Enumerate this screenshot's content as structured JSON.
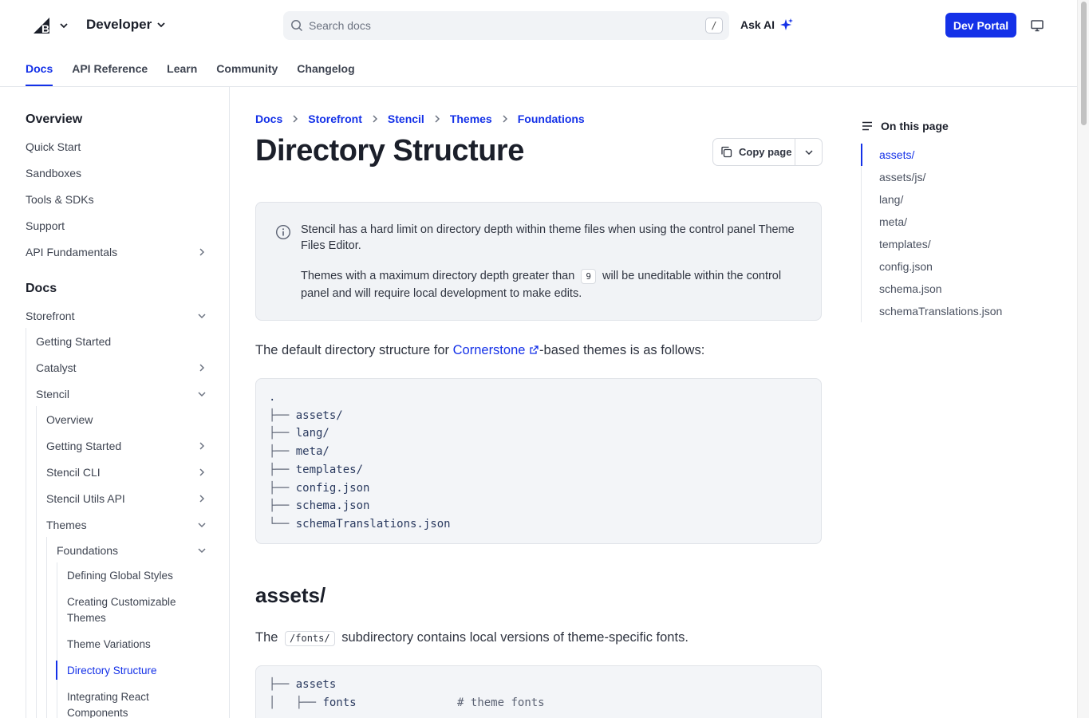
{
  "header": {
    "brand": "Developer",
    "search_placeholder": "Search docs",
    "search_shortcut": "/",
    "ask_ai": "Ask AI",
    "dev_portal": "Dev Portal"
  },
  "nav_tabs": [
    {
      "label": "Docs",
      "active": true
    },
    {
      "label": "API Reference"
    },
    {
      "label": "Learn"
    },
    {
      "label": "Community"
    },
    {
      "label": "Changelog"
    }
  ],
  "sidebar": {
    "section1_title": "Overview",
    "section1_items": [
      "Quick Start",
      "Sandboxes",
      "Tools & SDKs",
      "Support",
      "API Fundamentals"
    ],
    "section2_title": "Docs",
    "storefront": "Storefront",
    "getting_started": "Getting Started",
    "catalyst": "Catalyst",
    "stencil": "Stencil",
    "stencil_items": [
      "Overview",
      "Getting Started",
      "Stencil CLI",
      "Stencil Utils API",
      "Themes"
    ],
    "foundations": "Foundations",
    "foundation_items": [
      "Defining Global Styles",
      "Creating Customizable Themes",
      "Theme Variations",
      "Directory Structure",
      "Integrating React Components"
    ]
  },
  "breadcrumb": [
    "Docs",
    "Storefront",
    "Stencil",
    "Themes",
    "Foundations"
  ],
  "page": {
    "title": "Directory Structure",
    "copy_page": "Copy page",
    "note_p1": "Stencil has a hard limit on directory depth within theme files when using the control panel Theme Files Editor.",
    "note_p2_before": "Themes with a maximum directory depth greater than",
    "note_p2_code": "9",
    "note_p2_after": "will be uneditable within the control panel and will require local development to make edits.",
    "intro_before": "The default directory structure for",
    "intro_link": "Cornerstone",
    "intro_after": "-based themes is as follows:",
    "tree_root": ".",
    "tree_entries": [
      "assets/",
      "lang/",
      "meta/",
      "templates/",
      "config.json",
      "schema.json",
      "schemaTranslations.json"
    ],
    "section_heading": "assets/",
    "section_para_before": "The",
    "section_para_code": "/fonts/",
    "section_para_after": "subdirectory contains local versions of theme-specific fonts.",
    "assets_tree": {
      "root": "assets",
      "child": "fonts",
      "child_comment": "# theme fonts"
    }
  },
  "toc": {
    "title": "On this page",
    "items": [
      "assets/",
      "assets/js/",
      "lang/",
      "meta/",
      "templates/",
      "config.json",
      "schema.json",
      "schemaTranslations.json"
    ]
  },
  "colors": {
    "accent": "#1431e8",
    "text": "#2f3440",
    "note_bg": "#f1f3f6"
  }
}
